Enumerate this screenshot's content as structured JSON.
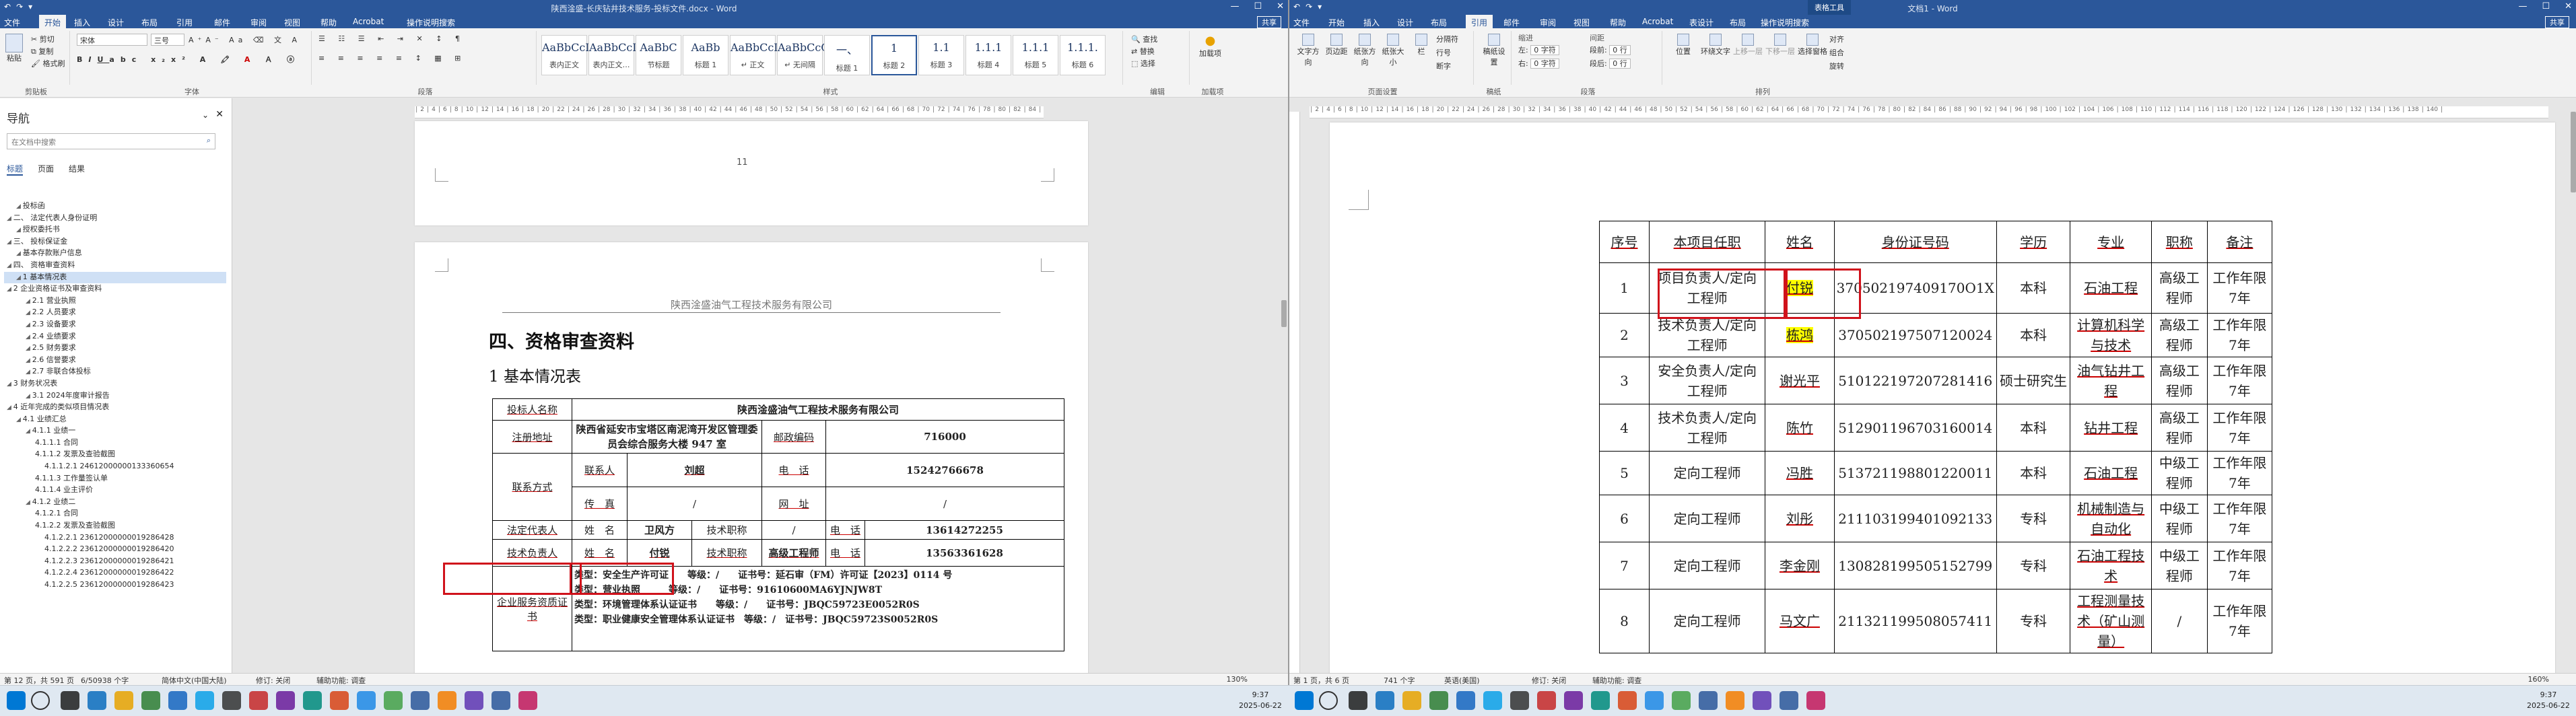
{
  "left": {
    "qat": [
      "↶",
      "↷",
      "▾"
    ],
    "title": "陕西淦盛-长庆钻井技术服务-投标文件.docx  -  Word",
    "window_controls": [
      "—",
      "☐",
      "✕"
    ],
    "tabs": [
      "文件",
      "开始",
      "插入",
      "设计",
      "布局",
      "引用",
      "邮件",
      "审阅",
      "视图",
      "帮助",
      "Acrobat",
      "操作说明搜索"
    ],
    "share": "共享",
    "ribbon": {
      "clipboard": {
        "label": "剪贴板",
        "paste": "粘贴",
        "cut": "剪切",
        "copy": "复制",
        "format_painter": "格式刷"
      },
      "font": {
        "label": "字体",
        "font_name": "宋体",
        "font_size": "三号"
      },
      "paragraph": {
        "label": "段落"
      },
      "styles": {
        "label": "样式",
        "items": [
          {
            "preview": "AaBbCcDd",
            "name": "表内正文"
          },
          {
            "preview": "AaBbCcDd",
            "name": "表内正文…"
          },
          {
            "preview": "AaBbC",
            "name": "节标题"
          },
          {
            "preview": "AaBb",
            "name": "标题 1"
          },
          {
            "preview": "AaBbCcDd",
            "name": "↵ 正文"
          },
          {
            "preview": "AaBbCcC",
            "name": "↵ 无间隔"
          },
          {
            "preview": "一、",
            "name": "标题 1"
          },
          {
            "preview": "1",
            "name": "标题 2"
          },
          {
            "preview": "1.1",
            "name": "标题 3"
          },
          {
            "preview": "1.1.1",
            "name": "标题 4"
          },
          {
            "preview": "1.1.1",
            "name": "标题 5"
          },
          {
            "preview": "1.1.1.",
            "name": "标题 6"
          }
        ]
      },
      "editing": {
        "label": "编辑",
        "find": "查找",
        "replace": "替换",
        "select": "选择"
      },
      "addins": {
        "label": "加载项",
        "name": "加载项"
      }
    },
    "nav": {
      "title": "导航",
      "search_placeholder": "在文档中搜索",
      "tabs": [
        "标题",
        "页面",
        "结果"
      ],
      "items": [
        {
          "text": "投标函",
          "level": 1
        },
        {
          "text": "二、 法定代表人身份证明",
          "level": 0
        },
        {
          "text": "授权委托书",
          "level": 1
        },
        {
          "text": "三、 投标保证金",
          "level": 0
        },
        {
          "text": "基本存款账户信息",
          "level": 1
        },
        {
          "text": "四、 资格审查资料",
          "level": 0
        },
        {
          "text": "1 基本情况表",
          "level": 1,
          "selected": true
        },
        {
          "text": "2 企业资格证书及审查资料",
          "level": 0
        },
        {
          "text": "2.1 营业执照",
          "level": 2
        },
        {
          "text": "2.2 人员要求",
          "level": 2
        },
        {
          "text": "2.3 设备要求",
          "level": 2
        },
        {
          "text": "2.4 业绩要求",
          "level": 2
        },
        {
          "text": "2.5 财务要求",
          "level": 2
        },
        {
          "text": "2.6 信誉要求",
          "level": 2
        },
        {
          "text": "2.7 非联合体投标",
          "level": 2
        },
        {
          "text": "3 财务状况表",
          "level": 0
        },
        {
          "text": "3.1 2024年度审计报告",
          "level": 2
        },
        {
          "text": "4 近年完成的类似项目情况表",
          "level": 0
        },
        {
          "text": "4.1 业绩汇总",
          "level": 1
        },
        {
          "text": "4.1.1 业绩一",
          "level": 2
        },
        {
          "text": "4.1.1.1 合同",
          "level": 3
        },
        {
          "text": "4.1.1.2 发票及查验截图",
          "level": 3
        },
        {
          "text": "4.1.1.2.1 24612000000133360654",
          "level": 4
        },
        {
          "text": "4.1.1.3 工作量签认单",
          "level": 3
        },
        {
          "text": "4.1.1.4 业主评价",
          "level": 3
        },
        {
          "text": "4.1.2 业绩二",
          "level": 2
        },
        {
          "text": "4.1.2.1 合同",
          "level": 3
        },
        {
          "text": "4.1.2.2 发票及查验截图",
          "level": 3
        },
        {
          "text": "4.1.2.2.1 23612000000019286428",
          "level": 4
        },
        {
          "text": "4.1.2.2.2 23612000000019286420",
          "level": 4
        },
        {
          "text": "4.1.2.2.3 23612000000019286421",
          "level": 4
        },
        {
          "text": "4.1.2.2.4 23612000000019286422",
          "level": 4
        },
        {
          "text": "4.1.2.2.5 23612000000019286423",
          "level": 4
        }
      ]
    },
    "page_number": "11",
    "header_text": "陕西淦盛油气工程技术服务有限公司",
    "heading1": "四、资格审查资料",
    "heading2": "1  基本情况表",
    "table": {
      "bidder_label": "投标人名称",
      "bidder_value": "陕西淦盛油气工程技术服务有限公司",
      "address_label": "注册地址",
      "address_value": "陕西省延安市宝塔区南泥湾开发区管理委员会综合服务大楼 947 室",
      "postcode_label": "邮政编码",
      "postcode_value": "716000",
      "contact_label": "联系方式",
      "contact_person_label": "联系人",
      "contact_person_value": "刘超",
      "phone_label": "电　话",
      "phone_value": "15242766678",
      "fax_label": "传　真",
      "fax_value": "/",
      "website_label": "网　址",
      "website_value": "/",
      "legal_rep_label": "法定代表人",
      "name_label": "姓　名",
      "legal_rep_name": "卫风方",
      "title_label": "技术职称",
      "legal_rep_title": "/",
      "legal_rep_phone": "13614272255",
      "tech_lead_label": "技术负责人",
      "tech_lead_name": "付锐",
      "tech_lead_title": "高级工程师",
      "tech_lead_phone": "13563361628",
      "cert_label": "企业服务资质证书",
      "certs": [
        "类型：安全生产许可证　　等级：/　　证书号：延石审（FM）许可证【2023】0114 号",
        "类型：营业执照　　　等级：/　　证书号：91610600MA6YJNJW8T",
        "类型：环境管理体系认证证书　　等级：/　　证书号：JBQC59723E0052R0S",
        "类型：职业健康安全管理体系认证证书　等级：/　证书号：JBQC59723S0052R0S"
      ]
    },
    "status": [
      "第 12 页，共 591 页",
      "6/50938 个字",
      "简体中文(中国大陆)",
      "修订: 关闭",
      "辅助功能: 调查"
    ],
    "zoom": "130%"
  },
  "right": {
    "title": "文档1 - Word",
    "context_tab": "表格工具",
    "tabs": [
      "文件",
      "开始",
      "插入",
      "设计",
      "布局",
      "引用",
      "邮件",
      "审阅",
      "视图",
      "帮助",
      "Acrobat",
      "表设计",
      "布局",
      "操作说明搜索"
    ],
    "share": "共享",
    "ribbon": {
      "page_setup": {
        "label": "页面设置",
        "items": [
          "文字方向",
          "页边距",
          "纸张方向",
          "纸张大小",
          "栏",
          "分隔符",
          "行号",
          "断字"
        ]
      },
      "draft": {
        "label": "稿纸",
        "name": "稿纸设置"
      },
      "paragraph": {
        "label": "段落",
        "indent": "缩进",
        "spacing": "间距",
        "left": "左:",
        "right": "右:",
        "before": "段前:",
        "after": "段后:",
        "left_val": "0 字符",
        "right_val": "0 字符",
        "before_val": "0 行",
        "after_val": "0 行"
      },
      "arrange": {
        "label": "排列",
        "items": [
          "位置",
          "环绕文字",
          "上移一层",
          "下移一层",
          "选择窗格",
          "对齐",
          "组合",
          "旋转"
        ]
      }
    },
    "table": {
      "headers": [
        "序号",
        "本项目任职",
        "姓名",
        "身份证号码",
        "学历",
        "专业",
        "职称",
        "备注"
      ],
      "rows": [
        [
          "1",
          "项目负责人/定向工程师",
          "付锐",
          "370502197409170O1X",
          "本科",
          "石油工程",
          "高级工程师",
          "工作年限7年"
        ],
        [
          "2",
          "技术负责人/定向工程师",
          "栋鸿",
          "370502197507120024",
          "本科",
          "计算机科学与技术",
          "高级工程师",
          "工作年限7年"
        ],
        [
          "3",
          "安全负责人/定向工程师",
          "谢光平",
          "510122197207281416",
          "硕士研究生",
          "油气钻井工程",
          "高级工程师",
          "工作年限7年"
        ],
        [
          "4",
          "技术负责人/定向工程师",
          "陈竹",
          "512901196703160014",
          "本科",
          "钻井工程",
          "高级工程师",
          "工作年限7年"
        ],
        [
          "5",
          "定向工程师",
          "冯胜",
          "513721198801220011",
          "本科",
          "石油工程",
          "中级工程师",
          "工作年限7年"
        ],
        [
          "6",
          "定向工程师",
          "刘彤",
          "211103199401092133",
          "专科",
          "机械制造与自动化",
          "中级工程师",
          "工作年限7年"
        ],
        [
          "7",
          "定向工程师",
          "李金刚",
          "130828199505152799",
          "专科",
          "石油工程技术",
          "中级工程师",
          "工作年限7年"
        ],
        [
          "8",
          "定向工程师",
          "马文广",
          "211321199508057411",
          "专科",
          "工程测量技术（矿山测量）",
          "/",
          "工作年限7年"
        ]
      ]
    },
    "status": [
      "第 1 页，共 6 页",
      "741 个字",
      "英语(美国)",
      "修订: 关闭",
      "辅助功能: 调查"
    ],
    "zoom": "160%"
  },
  "taskbar": {
    "time_left": "9:37",
    "date_left": "2025-06-22",
    "time_right": "9:37",
    "date_right": "2025-06-22"
  }
}
